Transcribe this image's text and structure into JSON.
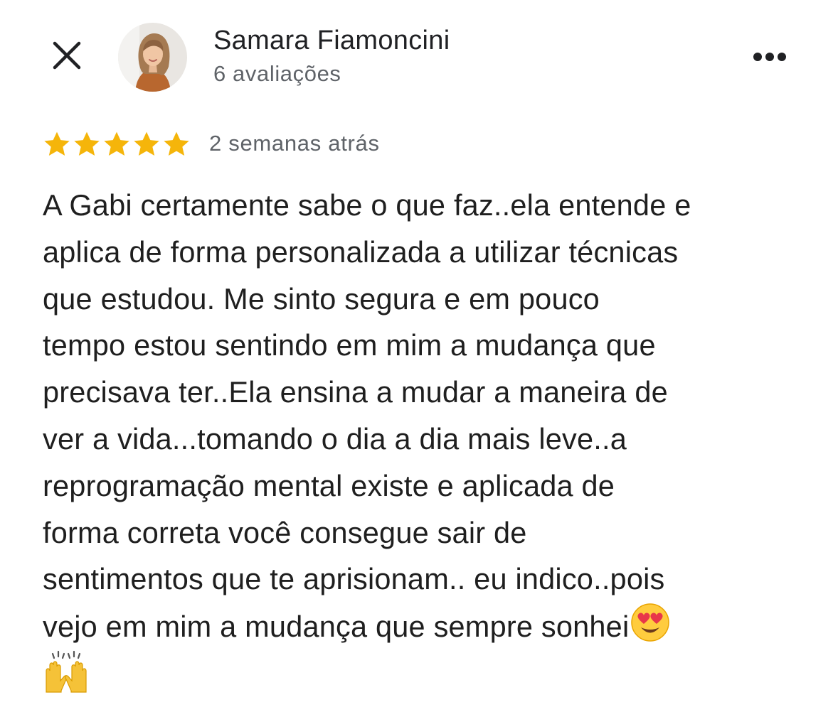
{
  "header": {
    "close_icon": "close-icon",
    "author_name": "Samara Fiamoncini",
    "review_count": "6 avaliações",
    "more_icon": "more-horizontal-icon"
  },
  "rating": {
    "stars": 5,
    "max_stars": 5,
    "star_color": "#f5b50a",
    "date": "2 semanas atrás"
  },
  "review": {
    "lines": [
      "A Gabi certamente sabe o que faz..ela entende e",
      "aplica de forma personalizada a utilizar técnicas",
      "que estudou. Me sinto segura e em pouco",
      "tempo estou sentindo em mim a mudança que",
      "precisava ter..Ela ensina a mudar a maneira de",
      "ver a vida...tomando o dia a dia mais leve..a",
      "reprogramação mental existe e aplicada de",
      "forma correta você consegue sair de",
      "sentimentos que te aprisionam.. eu indico..pois",
      "vejo em mim a mudança que sempre sonhei"
    ],
    "emojis": [
      "smiling-face-with-heart-eyes",
      "raising-hands"
    ]
  }
}
